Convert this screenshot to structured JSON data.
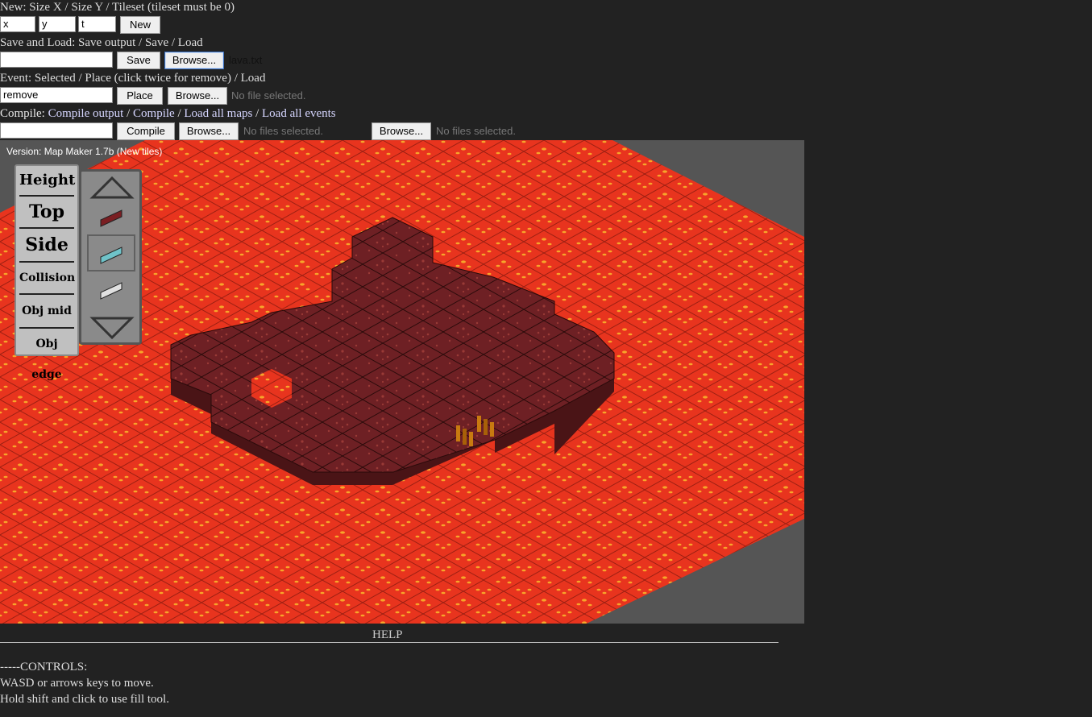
{
  "new_section": {
    "label": "New: Size X / Size Y / Tileset (tileset must be 0)",
    "x_value": "x",
    "y_value": "y",
    "t_value": "t",
    "new_button": "New"
  },
  "save_load": {
    "label": "Save and Load: Save output / Save / Load",
    "output_value": "",
    "save_button": "Save",
    "browse_button": "Browse...",
    "file_name": "lava.txt"
  },
  "event": {
    "label": "Event: Selected / Place (click twice for remove) / Load",
    "selected_value": "remove",
    "place_button": "Place",
    "browse_button": "Browse...",
    "file_status": "No file selected."
  },
  "compile": {
    "prefix": "Compile: ",
    "links": [
      "Compile output",
      "Compile",
      "Load all maps",
      "Load all events"
    ],
    "output_value": "",
    "compile_button": "Compile",
    "browse_maps_button": "Browse...",
    "maps_status": "No files selected.",
    "browse_events_button": "Browse...",
    "events_status": "No files selected."
  },
  "editor": {
    "version": "Version: Map Maker 1.7b (New tiles)",
    "modes": [
      "Height",
      "Top",
      "Side",
      "Collision",
      "Obj mid",
      "Obj edge"
    ],
    "selected_mode": "Side",
    "tile_swatches": [
      "dark-red-tile",
      "cyan-tile",
      "white-tile"
    ],
    "selected_tile": "cyan-tile",
    "colors": {
      "lava": "#e8341e",
      "lava_dot": "#f7a52a",
      "block_top": "#6e2024",
      "block_side": "#4a1416",
      "background": "#555555"
    }
  },
  "help": {
    "title": "HELP",
    "lines": [
      "-----CONTROLS:",
      "WASD or arrows keys to move.",
      "Hold shift and click to use fill tool."
    ]
  }
}
